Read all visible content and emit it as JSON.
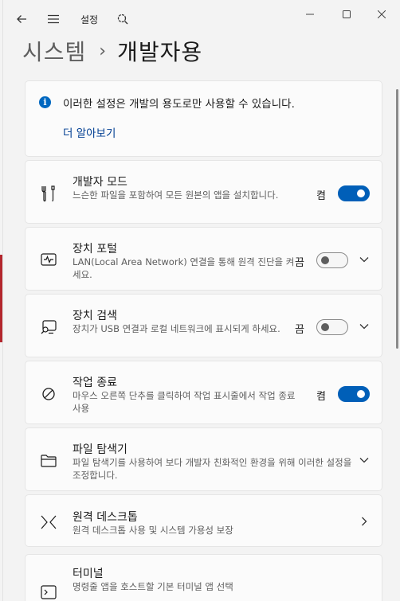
{
  "window": {
    "app_title": "설정",
    "back_icon": "back-arrow-icon",
    "menu_icon": "hamburger-menu-icon",
    "settings_icon": "settings-search-icon"
  },
  "breadcrumb": {
    "parent": "시스템",
    "separator": "›",
    "current": "개발자용"
  },
  "info": {
    "icon_text": "i",
    "text": "이러한 설정은 개발의 용도로만 사용할 수 있습니다.",
    "link": "더 알아보기"
  },
  "settings": [
    {
      "title": "개발자 모드",
      "desc": "느슨한 파일을 포함하여 모든 원본의 앱을 설치합니다.",
      "state": "켬",
      "toggle": "on",
      "chevron": false
    },
    {
      "title": "장치 포털",
      "desc": "LAN(Local Area Network) 연결을 통해 원격 진단을 켜세요.",
      "state": "끔",
      "toggle": "off",
      "chevron": "down"
    },
    {
      "title": "장치 검색",
      "desc": "장치가 USB 연결과 로컬 네트워크에 표시되게 하세요.",
      "state": "끔",
      "toggle": "off",
      "chevron": "down"
    },
    {
      "title": "작업 종료",
      "desc": "마우스 오른쪽 단추를 클릭하여 작업 표시줄에서 작업 종료 사용",
      "state": "켬",
      "toggle": "on",
      "chevron": false
    },
    {
      "title": "파일 탐색기",
      "desc": "파일 탐색기를 사용하여 보다 개발자 친화적인 환경을 위해 이러한 설정을 조정합니다.",
      "chevron": "down"
    },
    {
      "title": "원격 데스크톱",
      "desc": "원격 데스크톱 사용 및 시스템 가용성 보장",
      "chevron": "right"
    },
    {
      "title": "터미널",
      "desc": "명령줄 앱을 호스트할 기본 터미널 앱 선택"
    }
  ],
  "colors": {
    "accent": "#005fb8",
    "link": "#003e92",
    "background": "#f3f3f3",
    "card": "#fbfbfb"
  }
}
